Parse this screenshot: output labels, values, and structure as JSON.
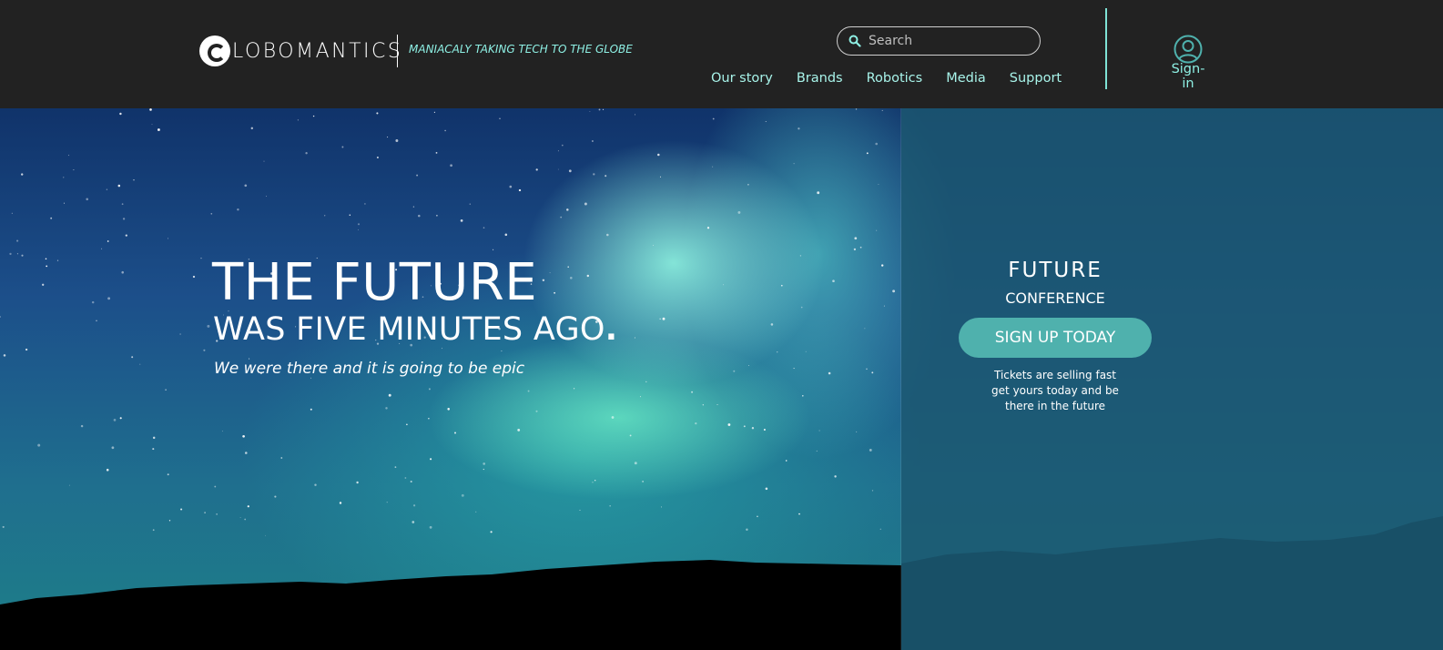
{
  "header": {
    "logo_text": "LOBOMANTICS",
    "tagline": "MANIACALY TAKING TECH TO THE GLOBE",
    "search_placeholder": "Search",
    "nav": [
      "Our story",
      "Brands",
      "Robotics",
      "Media",
      "Support"
    ],
    "signin_label": "Sign-in"
  },
  "hero": {
    "headline": "THE FUTURE",
    "subhead": "WAS FIVE MINUTES AGO",
    "subhead_dot": ".",
    "tagline": "We were there and it is going to be epic"
  },
  "conference": {
    "title": "FUTURE",
    "subtitle": "CONFERENCE",
    "button_label": "SIGN UP TODAY",
    "ticket_lines": [
      "Tickets are selling fast",
      "get yours today and be",
      "there in the future"
    ]
  },
  "colors": {
    "header_bg": "#222222",
    "accent": "#8ef0e4",
    "button": "#4fb1ad",
    "panel": "#1c5870"
  },
  "icons": {
    "logo": "globe-g-icon",
    "search": "search-icon",
    "signin": "user-circle-icon"
  }
}
